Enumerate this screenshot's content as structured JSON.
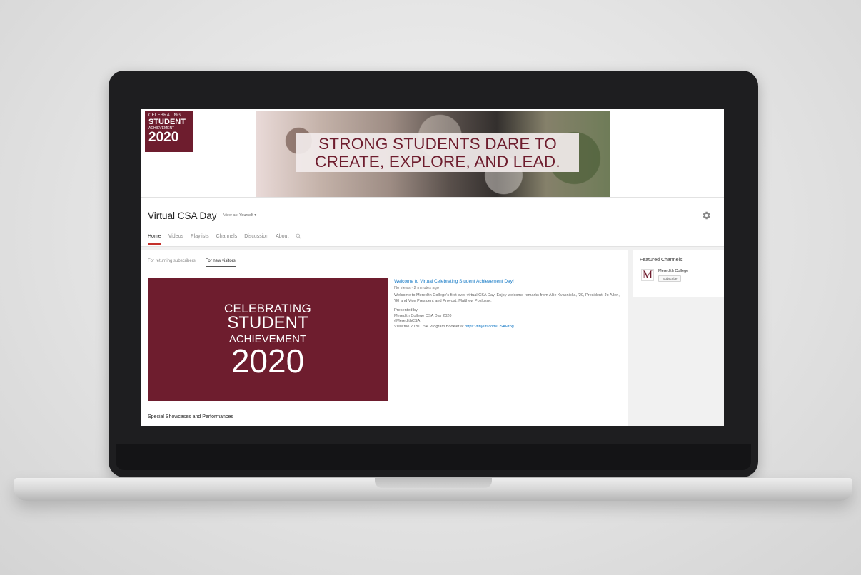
{
  "banner": {
    "logo": {
      "line1": "CELEBRATING",
      "line2": "STUDENT",
      "line3": "ACHIEVEMENT",
      "line4": "2020"
    },
    "tagline_line1": "STRONG STUDENTS DARE TO",
    "tagline_line2": "CREATE, EXPLORE, AND LEAD."
  },
  "channel": {
    "title": "Virtual CSA Day",
    "view_as_label": "View as:",
    "view_as_value": "Yourself ▾"
  },
  "tabs": [
    "Home",
    "Videos",
    "Playlists",
    "Channels",
    "Discussion",
    "About"
  ],
  "subtabs": [
    "For returning subscribers",
    "For new visitors"
  ],
  "featured_video": {
    "thumb_line1": "CELEBRATING",
    "thumb_line2": "STUDENT",
    "thumb_line3": "ACHIEVEMENT",
    "thumb_line4": "2020",
    "title": "Welcome to Virtual Celebrating Student Achievement Day!",
    "meta": "No views · 2 minutes ago",
    "description": "Welcome to Meredith College's first ever virtual CSA Day. Enjoy welcome remarks from Allie Kvasnicka, '20, President, Jo Allen, '80 and Vice President and Provost, Matthew Poslusny.",
    "presented_by": "Presented by",
    "presenter": "Meredith College CSA Day 2020",
    "hashtag": "#MeredithCSA",
    "booklet_text": "View the 2020 CSA Program Booklet at ",
    "booklet_link": "https://tinyurl.com/CSAProg..."
  },
  "section_title": "Special Showcases and Performances",
  "sidebar": {
    "title": "Featured Channels",
    "logo_letter": "M",
    "channel_name": "Meredith College",
    "subscribe_label": "Subscribe"
  },
  "colors": {
    "brand_maroon": "#6e1d2e",
    "link_blue": "#167ac6",
    "tab_active_red": "#c4302b"
  },
  "icons": [
    "gear-icon",
    "search-icon"
  ]
}
